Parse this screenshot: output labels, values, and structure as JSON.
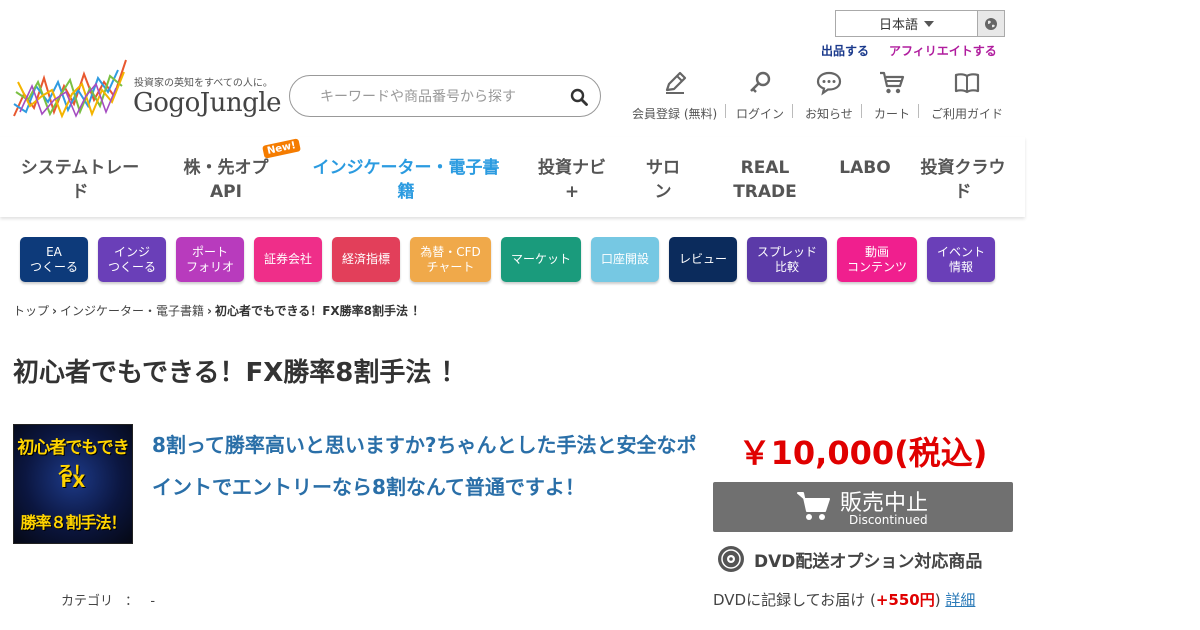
{
  "header": {
    "language": "日本語",
    "sell_link": "出品する",
    "affiliate_link": "アフィリエイトする",
    "tagline": "投資家の英知をすべての人に。",
    "brand": "GogoJungle",
    "search_placeholder": "キーワードや商品番号から探す"
  },
  "user_nav": [
    {
      "label": "会員登録 (無料)",
      "icon": "pencil-icon"
    },
    {
      "label": "ログイン",
      "icon": "key-icon"
    },
    {
      "label": "お知らせ",
      "icon": "chat-bubble-icon"
    },
    {
      "label": "カート",
      "icon": "cart-icon"
    },
    {
      "label": "ご利用ガイド",
      "icon": "book-icon"
    }
  ],
  "main_nav": [
    {
      "line1": "システムトレー",
      "line2": "ド"
    },
    {
      "line1": "株・先オプ",
      "line2": "API",
      "badge": "New!"
    },
    {
      "line1": "インジケーター・電子書",
      "line2": "籍",
      "active": true
    },
    {
      "line1": "投資ナビ",
      "line2": "+"
    },
    {
      "line1": "サロ",
      "line2": "ン"
    },
    {
      "line1": "REAL",
      "line2": "TRADE"
    },
    {
      "line1": "LABO",
      "line2": ""
    },
    {
      "line1": "投資クラウ",
      "line2": "ド"
    }
  ],
  "categories": [
    {
      "line1": "EA",
      "line2": "つくーる",
      "color": "#0d3a7a"
    },
    {
      "line1": "インジ",
      "line2": "つくーる",
      "color": "#6a3fb8"
    },
    {
      "line1": "ポート",
      "line2": "フォリオ",
      "color": "#b83bbd"
    },
    {
      "line1": "証券会社",
      "line2": "",
      "color": "#ef2e89"
    },
    {
      "line1": "経済指標",
      "line2": "",
      "color": "#e23f5a"
    },
    {
      "line1": "為替・CFD",
      "line2": "チャート",
      "color": "#f0a94a"
    },
    {
      "line1": "マーケット",
      "line2": "",
      "color": "#1a9b7c"
    },
    {
      "line1": "口座開設",
      "line2": "",
      "color": "#76c8e3"
    },
    {
      "line1": "レビュー",
      "line2": "",
      "color": "#0b2b5c"
    },
    {
      "line1": "スプレッド",
      "line2": "比較",
      "color": "#5b3aa8"
    },
    {
      "line1": "動画",
      "line2": "コンテンツ",
      "color": "#f01f8e"
    },
    {
      "line1": "イベント",
      "line2": "情報",
      "color": "#6a3fb8"
    }
  ],
  "breadcrumb": [
    "トップ",
    "インジケーター・電子書籍",
    "初心者でもできる！FX勝率8割手法 ！"
  ],
  "product": {
    "title": "初心者でもできる！FX勝率8割手法 ！",
    "cover_line1": "初心者でもできる！",
    "cover_line2": "FX",
    "cover_line3": "勝率８割手法！",
    "catch_copy": "8割って勝率高いと思いますか?ちゃんとした手法と安全なポイントでエントリーなら8割なんて普通ですよ！",
    "category_label": "カテゴリ",
    "category_sep": "：",
    "category_value": "-",
    "price": "￥10,000(税込)",
    "status_main": "販売中止",
    "status_sub": "Discontinued",
    "dvd_title": "DVD配送オプション対応商品",
    "dvd_note_prefix": "DVDに記録してお届け (",
    "dvd_note_price": "+550円",
    "dvd_note_suffix": ")",
    "dvd_detail_link": "詳細"
  }
}
